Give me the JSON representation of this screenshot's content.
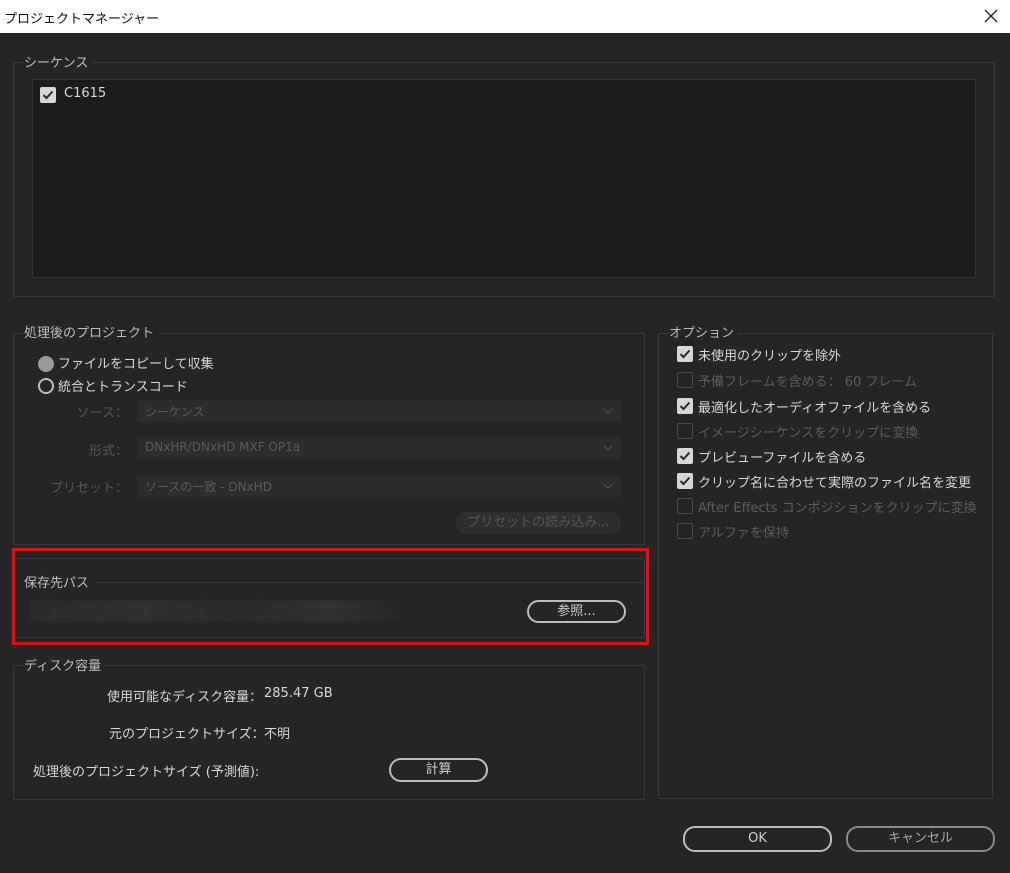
{
  "window": {
    "title": "プロジェクトマネージャー"
  },
  "sequences": {
    "label": "シーケンス",
    "items": [
      {
        "name": "C1615",
        "checked": true
      }
    ]
  },
  "processed_project": {
    "label": "処理後のプロジェクト",
    "radio_collect": "ファイルをコピーして収集",
    "radio_consolidate": "統合とトランスコード",
    "source_label": "ソース：",
    "source_value": "シーケンス",
    "format_label": "形式：",
    "format_value": "DNxHR/DNxHD MXF OP1a",
    "preset_label": "プリセット：",
    "preset_value": "ソースの一致 - DNxHD",
    "load_preset_label": "プリセットの読み込み..."
  },
  "destination": {
    "label": "保存先パス",
    "browse_label": "参照..."
  },
  "disk": {
    "label": "ディスク容量",
    "available_label": "使用可能なディスク容量：",
    "available_value": "285.47 GB",
    "original_size_label": "元のプロジェクトサイズ：",
    "original_size_value": "不明",
    "estimated_label": "処理後のプロジェクトサイズ (予測値):",
    "calculate_label": "計算"
  },
  "options": {
    "label": "オプション",
    "items": [
      {
        "label": "未使用のクリップを除外",
        "checked": true,
        "enabled": true
      },
      {
        "label": "予備フレームを含める：   60   フレーム",
        "checked": false,
        "enabled": false
      },
      {
        "label": "最適化したオーディオファイルを含める",
        "checked": true,
        "enabled": true
      },
      {
        "label": "イメージシーケンスをクリップに変換",
        "checked": false,
        "enabled": false
      },
      {
        "label": "プレビューファイルを含める",
        "checked": true,
        "enabled": true
      },
      {
        "label": "クリップ名に合わせて実際のファイル名を変更",
        "checked": true,
        "enabled": true
      },
      {
        "label": "After Effects コンポジションをクリップに変換",
        "checked": false,
        "enabled": false
      },
      {
        "label": "アルファを保持",
        "checked": false,
        "enabled": false
      }
    ]
  },
  "footer": {
    "ok_label": "OK",
    "cancel_label": "キャンセル"
  },
  "colors": {
    "highlight": "#d0151b",
    "background": "#252525"
  }
}
